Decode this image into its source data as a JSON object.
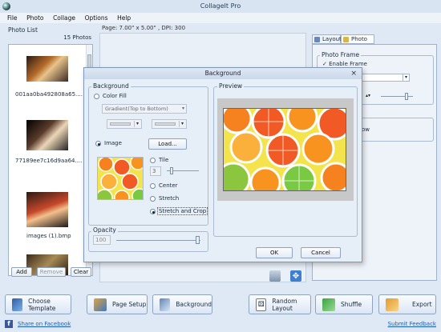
{
  "app": {
    "title": "CollageIt Pro"
  },
  "menu": [
    "File",
    "Photo",
    "Collage",
    "Options",
    "Help"
  ],
  "page_info": "Page:  7.00\" x 5.00\" , DPI: 300",
  "photo_list": {
    "title": "Photo List",
    "count": "15 Photos",
    "items": [
      {
        "name": "001aa0ba492808a65...."
      },
      {
        "name": "77189ee7c16d9aa64...."
      },
      {
        "name": "images (1).bmp"
      }
    ],
    "add": "Add",
    "remove": "Remove",
    "clear": "Clear"
  },
  "right_panel": {
    "tabs": [
      "Layout",
      "Photo"
    ],
    "photo_frame": "Photo Frame",
    "enable_frame": "Enable Frame",
    "row_label": "ow"
  },
  "dialog": {
    "title": "Background",
    "background_group": "Background",
    "color_fill": "Color Fill",
    "gradient_select": "Gradient(Top to Bottom)",
    "image": "Image",
    "load": "Load...",
    "tile": "Tile",
    "tile_value": "3",
    "center": "Center",
    "stretch": "Stretch",
    "stretch_crop": "Stretch and Crop",
    "opacity_group": "Opacity",
    "opacity_value": "100",
    "preview": "Preview",
    "ok": "OK",
    "cancel": "Cancel"
  },
  "toolbar": {
    "choose_template": "Choose Template",
    "page_setup": "Page Setup",
    "background": "Background",
    "random_layout": "Random Layout",
    "shuffle": "Shuffle",
    "export": "Export"
  },
  "footer": {
    "share": "Share on Facebook",
    "feedback": "Submit Feedback"
  },
  "icons": {
    "app": "collageit-logo-icon",
    "close": "close-icon",
    "facebook": "facebook-icon"
  }
}
